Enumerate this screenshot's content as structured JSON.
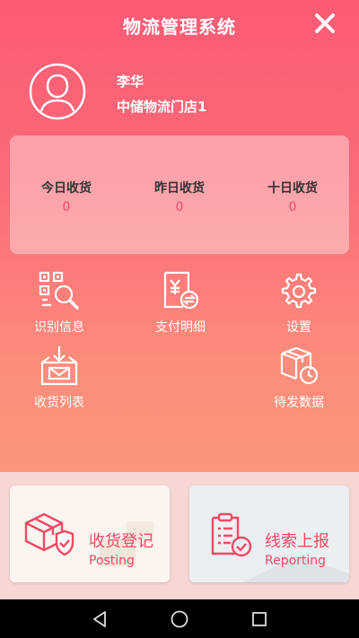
{
  "header": {
    "title": "物流管理系统"
  },
  "user": {
    "name": "李华",
    "store": "中储物流门店1"
  },
  "stats": [
    {
      "label": "今日收货",
      "value": "0"
    },
    {
      "label": "昨日收货",
      "value": "0"
    },
    {
      "label": "十日收货",
      "value": "0"
    }
  ],
  "menu": {
    "identify": "识别信息",
    "payment": "支付明细",
    "settings": "设置",
    "receive_list": "收货列表",
    "pending": "待发数据"
  },
  "cards": {
    "receive": {
      "title": "收货登记",
      "subtitle": "Posting"
    },
    "report": {
      "title": "线索上报",
      "subtitle": "Reporting"
    }
  },
  "colors": {
    "accent": "#f04a64",
    "gradient_top": "#fb5b75",
    "gradient_bottom": "#fca07d"
  }
}
